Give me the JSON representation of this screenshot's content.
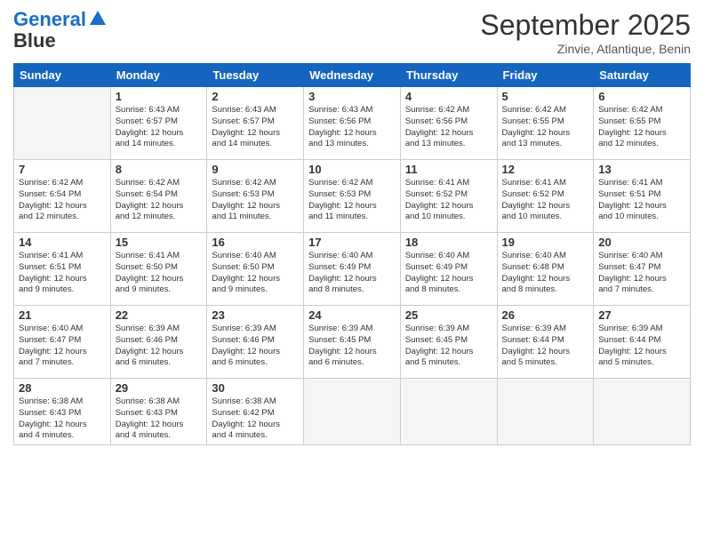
{
  "header": {
    "logo_line1": "General",
    "logo_line2": "Blue",
    "month": "September 2025",
    "location": "Zinvie, Atlantique, Benin"
  },
  "weekdays": [
    "Sunday",
    "Monday",
    "Tuesday",
    "Wednesday",
    "Thursday",
    "Friday",
    "Saturday"
  ],
  "weeks": [
    [
      {
        "day": "",
        "info": ""
      },
      {
        "day": "1",
        "info": "Sunrise: 6:43 AM\nSunset: 6:57 PM\nDaylight: 12 hours\nand 14 minutes."
      },
      {
        "day": "2",
        "info": "Sunrise: 6:43 AM\nSunset: 6:57 PM\nDaylight: 12 hours\nand 14 minutes."
      },
      {
        "day": "3",
        "info": "Sunrise: 6:43 AM\nSunset: 6:56 PM\nDaylight: 12 hours\nand 13 minutes."
      },
      {
        "day": "4",
        "info": "Sunrise: 6:42 AM\nSunset: 6:56 PM\nDaylight: 12 hours\nand 13 minutes."
      },
      {
        "day": "5",
        "info": "Sunrise: 6:42 AM\nSunset: 6:55 PM\nDaylight: 12 hours\nand 13 minutes."
      },
      {
        "day": "6",
        "info": "Sunrise: 6:42 AM\nSunset: 6:55 PM\nDaylight: 12 hours\nand 12 minutes."
      }
    ],
    [
      {
        "day": "7",
        "info": "Sunrise: 6:42 AM\nSunset: 6:54 PM\nDaylight: 12 hours\nand 12 minutes."
      },
      {
        "day": "8",
        "info": "Sunrise: 6:42 AM\nSunset: 6:54 PM\nDaylight: 12 hours\nand 12 minutes."
      },
      {
        "day": "9",
        "info": "Sunrise: 6:42 AM\nSunset: 6:53 PM\nDaylight: 12 hours\nand 11 minutes."
      },
      {
        "day": "10",
        "info": "Sunrise: 6:42 AM\nSunset: 6:53 PM\nDaylight: 12 hours\nand 11 minutes."
      },
      {
        "day": "11",
        "info": "Sunrise: 6:41 AM\nSunset: 6:52 PM\nDaylight: 12 hours\nand 10 minutes."
      },
      {
        "day": "12",
        "info": "Sunrise: 6:41 AM\nSunset: 6:52 PM\nDaylight: 12 hours\nand 10 minutes."
      },
      {
        "day": "13",
        "info": "Sunrise: 6:41 AM\nSunset: 6:51 PM\nDaylight: 12 hours\nand 10 minutes."
      }
    ],
    [
      {
        "day": "14",
        "info": "Sunrise: 6:41 AM\nSunset: 6:51 PM\nDaylight: 12 hours\nand 9 minutes."
      },
      {
        "day": "15",
        "info": "Sunrise: 6:41 AM\nSunset: 6:50 PM\nDaylight: 12 hours\nand 9 minutes."
      },
      {
        "day": "16",
        "info": "Sunrise: 6:40 AM\nSunset: 6:50 PM\nDaylight: 12 hours\nand 9 minutes."
      },
      {
        "day": "17",
        "info": "Sunrise: 6:40 AM\nSunset: 6:49 PM\nDaylight: 12 hours\nand 8 minutes."
      },
      {
        "day": "18",
        "info": "Sunrise: 6:40 AM\nSunset: 6:49 PM\nDaylight: 12 hours\nand 8 minutes."
      },
      {
        "day": "19",
        "info": "Sunrise: 6:40 AM\nSunset: 6:48 PM\nDaylight: 12 hours\nand 8 minutes."
      },
      {
        "day": "20",
        "info": "Sunrise: 6:40 AM\nSunset: 6:47 PM\nDaylight: 12 hours\nand 7 minutes."
      }
    ],
    [
      {
        "day": "21",
        "info": "Sunrise: 6:40 AM\nSunset: 6:47 PM\nDaylight: 12 hours\nand 7 minutes."
      },
      {
        "day": "22",
        "info": "Sunrise: 6:39 AM\nSunset: 6:46 PM\nDaylight: 12 hours\nand 6 minutes."
      },
      {
        "day": "23",
        "info": "Sunrise: 6:39 AM\nSunset: 6:46 PM\nDaylight: 12 hours\nand 6 minutes."
      },
      {
        "day": "24",
        "info": "Sunrise: 6:39 AM\nSunset: 6:45 PM\nDaylight: 12 hours\nand 6 minutes."
      },
      {
        "day": "25",
        "info": "Sunrise: 6:39 AM\nSunset: 6:45 PM\nDaylight: 12 hours\nand 5 minutes."
      },
      {
        "day": "26",
        "info": "Sunrise: 6:39 AM\nSunset: 6:44 PM\nDaylight: 12 hours\nand 5 minutes."
      },
      {
        "day": "27",
        "info": "Sunrise: 6:39 AM\nSunset: 6:44 PM\nDaylight: 12 hours\nand 5 minutes."
      }
    ],
    [
      {
        "day": "28",
        "info": "Sunrise: 6:38 AM\nSunset: 6:43 PM\nDaylight: 12 hours\nand 4 minutes."
      },
      {
        "day": "29",
        "info": "Sunrise: 6:38 AM\nSunset: 6:43 PM\nDaylight: 12 hours\nand 4 minutes."
      },
      {
        "day": "30",
        "info": "Sunrise: 6:38 AM\nSunset: 6:42 PM\nDaylight: 12 hours\nand 4 minutes."
      },
      {
        "day": "",
        "info": ""
      },
      {
        "day": "",
        "info": ""
      },
      {
        "day": "",
        "info": ""
      },
      {
        "day": "",
        "info": ""
      }
    ]
  ]
}
